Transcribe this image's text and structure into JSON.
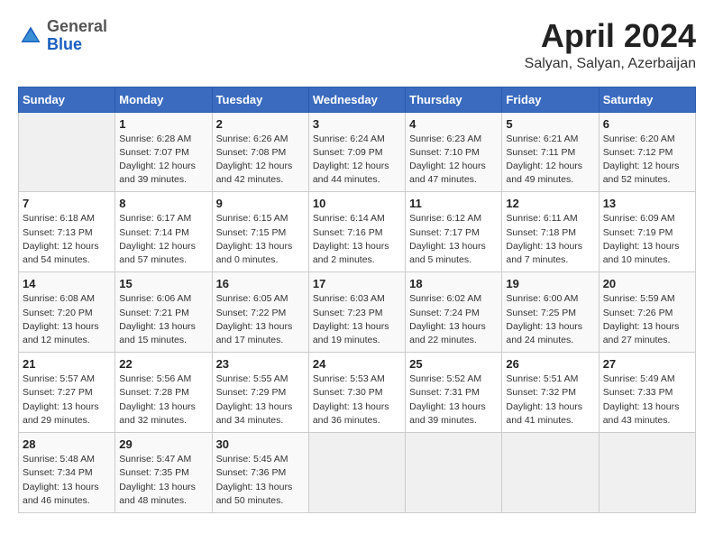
{
  "logo": {
    "general": "General",
    "blue": "Blue"
  },
  "header": {
    "month_year": "April 2024",
    "location": "Salyan, Salyan, Azerbaijan"
  },
  "weekdays": [
    "Sunday",
    "Monday",
    "Tuesday",
    "Wednesday",
    "Thursday",
    "Friday",
    "Saturday"
  ],
  "weeks": [
    [
      null,
      {
        "day": 1,
        "sunrise": "6:28 AM",
        "sunset": "7:07 PM",
        "daylight": "12 hours and 39 minutes."
      },
      {
        "day": 2,
        "sunrise": "6:26 AM",
        "sunset": "7:08 PM",
        "daylight": "12 hours and 42 minutes."
      },
      {
        "day": 3,
        "sunrise": "6:24 AM",
        "sunset": "7:09 PM",
        "daylight": "12 hours and 44 minutes."
      },
      {
        "day": 4,
        "sunrise": "6:23 AM",
        "sunset": "7:10 PM",
        "daylight": "12 hours and 47 minutes."
      },
      {
        "day": 5,
        "sunrise": "6:21 AM",
        "sunset": "7:11 PM",
        "daylight": "12 hours and 49 minutes."
      },
      {
        "day": 6,
        "sunrise": "6:20 AM",
        "sunset": "7:12 PM",
        "daylight": "12 hours and 52 minutes."
      }
    ],
    [
      {
        "day": 7,
        "sunrise": "6:18 AM",
        "sunset": "7:13 PM",
        "daylight": "12 hours and 54 minutes."
      },
      {
        "day": 8,
        "sunrise": "6:17 AM",
        "sunset": "7:14 PM",
        "daylight": "12 hours and 57 minutes."
      },
      {
        "day": 9,
        "sunrise": "6:15 AM",
        "sunset": "7:15 PM",
        "daylight": "13 hours and 0 minutes."
      },
      {
        "day": 10,
        "sunrise": "6:14 AM",
        "sunset": "7:16 PM",
        "daylight": "13 hours and 2 minutes."
      },
      {
        "day": 11,
        "sunrise": "6:12 AM",
        "sunset": "7:17 PM",
        "daylight": "13 hours and 5 minutes."
      },
      {
        "day": 12,
        "sunrise": "6:11 AM",
        "sunset": "7:18 PM",
        "daylight": "13 hours and 7 minutes."
      },
      {
        "day": 13,
        "sunrise": "6:09 AM",
        "sunset": "7:19 PM",
        "daylight": "13 hours and 10 minutes."
      }
    ],
    [
      {
        "day": 14,
        "sunrise": "6:08 AM",
        "sunset": "7:20 PM",
        "daylight": "13 hours and 12 minutes."
      },
      {
        "day": 15,
        "sunrise": "6:06 AM",
        "sunset": "7:21 PM",
        "daylight": "13 hours and 15 minutes."
      },
      {
        "day": 16,
        "sunrise": "6:05 AM",
        "sunset": "7:22 PM",
        "daylight": "13 hours and 17 minutes."
      },
      {
        "day": 17,
        "sunrise": "6:03 AM",
        "sunset": "7:23 PM",
        "daylight": "13 hours and 19 minutes."
      },
      {
        "day": 18,
        "sunrise": "6:02 AM",
        "sunset": "7:24 PM",
        "daylight": "13 hours and 22 minutes."
      },
      {
        "day": 19,
        "sunrise": "6:00 AM",
        "sunset": "7:25 PM",
        "daylight": "13 hours and 24 minutes."
      },
      {
        "day": 20,
        "sunrise": "5:59 AM",
        "sunset": "7:26 PM",
        "daylight": "13 hours and 27 minutes."
      }
    ],
    [
      {
        "day": 21,
        "sunrise": "5:57 AM",
        "sunset": "7:27 PM",
        "daylight": "13 hours and 29 minutes."
      },
      {
        "day": 22,
        "sunrise": "5:56 AM",
        "sunset": "7:28 PM",
        "daylight": "13 hours and 32 minutes."
      },
      {
        "day": 23,
        "sunrise": "5:55 AM",
        "sunset": "7:29 PM",
        "daylight": "13 hours and 34 minutes."
      },
      {
        "day": 24,
        "sunrise": "5:53 AM",
        "sunset": "7:30 PM",
        "daylight": "13 hours and 36 minutes."
      },
      {
        "day": 25,
        "sunrise": "5:52 AM",
        "sunset": "7:31 PM",
        "daylight": "13 hours and 39 minutes."
      },
      {
        "day": 26,
        "sunrise": "5:51 AM",
        "sunset": "7:32 PM",
        "daylight": "13 hours and 41 minutes."
      },
      {
        "day": 27,
        "sunrise": "5:49 AM",
        "sunset": "7:33 PM",
        "daylight": "13 hours and 43 minutes."
      }
    ],
    [
      {
        "day": 28,
        "sunrise": "5:48 AM",
        "sunset": "7:34 PM",
        "daylight": "13 hours and 46 minutes."
      },
      {
        "day": 29,
        "sunrise": "5:47 AM",
        "sunset": "7:35 PM",
        "daylight": "13 hours and 48 minutes."
      },
      {
        "day": 30,
        "sunrise": "5:45 AM",
        "sunset": "7:36 PM",
        "daylight": "13 hours and 50 minutes."
      },
      null,
      null,
      null,
      null
    ]
  ],
  "labels": {
    "sunrise": "Sunrise:",
    "sunset": "Sunset:",
    "daylight": "Daylight:"
  }
}
